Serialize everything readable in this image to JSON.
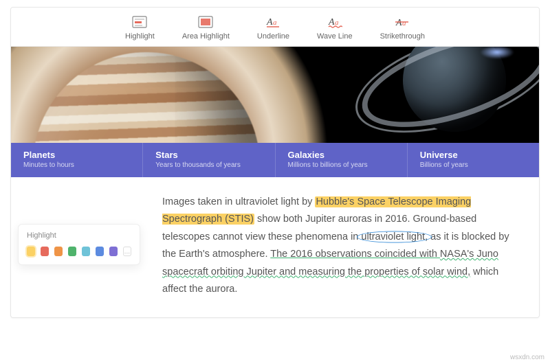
{
  "toolbar": {
    "tools": [
      {
        "label": "Highlight",
        "icon": "highlight"
      },
      {
        "label": "Area Highlight",
        "icon": "area-highlight"
      },
      {
        "label": "Underline",
        "icon": "underline"
      },
      {
        "label": "Wave Line",
        "icon": "waveline"
      },
      {
        "label": "Strikethrough",
        "icon": "strikethrough"
      }
    ]
  },
  "hero": {
    "planet_left": "jupiter",
    "planet_right": "saturn"
  },
  "categories": [
    {
      "title": "Planets",
      "subtitle": "Minutes to hours"
    },
    {
      "title": "Stars",
      "subtitle": "Years to thousands of years"
    },
    {
      "title": "Galaxies",
      "subtitle": "Millions to billions of years"
    },
    {
      "title": "Universe",
      "subtitle": "Billions of years"
    }
  ],
  "paragraph": {
    "t1": "Images taken in ultraviolet light by ",
    "hl": "Hubble's Space Telescope Imaging Spectrograph (STIS)",
    "t2": " show both Jupiter auroras in 2016. Ground-based telescopes cannot view these phenomena in ",
    "circled": "ultraviolet light,",
    "t3": " as it is blocked by  the Earth's atmosphere. ",
    "ul": "The 2016 observations coincided with ",
    "wavy": "NASA's Juno  spacecraft orbiting Jupiter and measuring the properties of solar wind,",
    "t4": " which affect the aurora."
  },
  "color_panel": {
    "title": "Highlight",
    "swatches": [
      "#fbd164",
      "#e66a5c",
      "#ef9447",
      "#4fb36c",
      "#6fc3d8",
      "#5c8be0",
      "#7e6fd4"
    ],
    "selected_index": 0,
    "more_label": "…"
  },
  "watermark": "wsxdn.com"
}
